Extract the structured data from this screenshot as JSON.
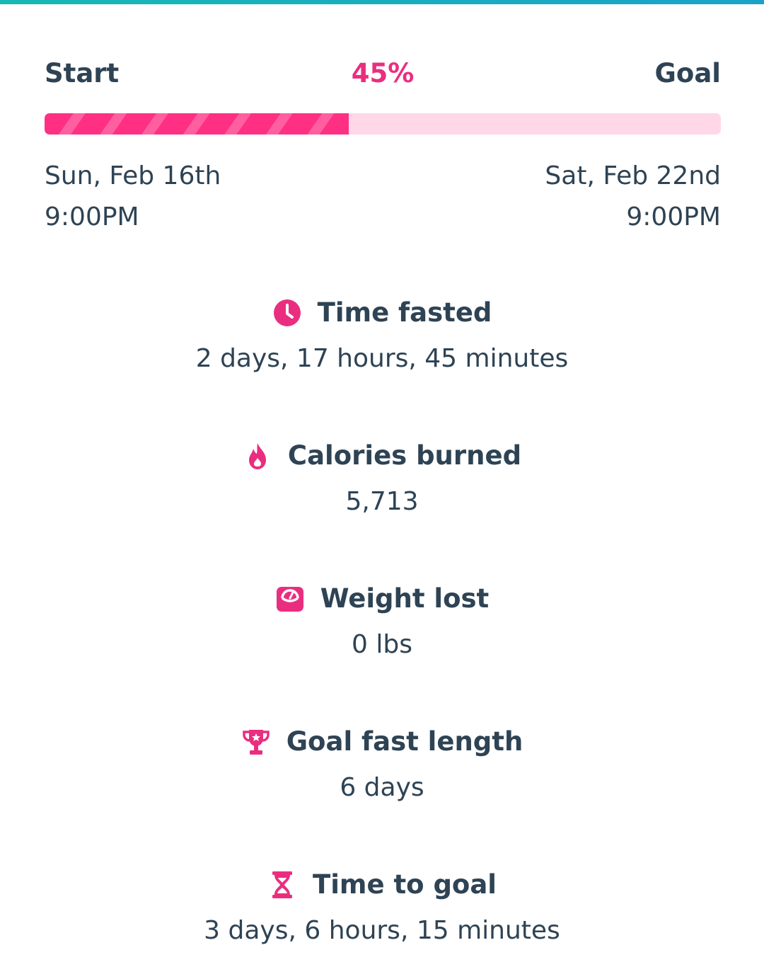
{
  "progress": {
    "start_label": "Start",
    "percent_label": "45%",
    "goal_label": "Goal",
    "percent_value": 0.45,
    "start_date": "Sun, Feb 16th",
    "start_time": "9:00PM",
    "goal_date": "Sat, Feb 22nd",
    "goal_time": "9:00PM"
  },
  "colors": {
    "accent": "#ea2e7f",
    "text": "#2e4354",
    "track": "#ffd7e7",
    "top_strip": "#16b9b3"
  },
  "stats": [
    {
      "icon": "clock-icon",
      "title": "Time fasted",
      "value": "2 days, 17 hours, 45 minutes"
    },
    {
      "icon": "flame-icon",
      "title": "Calories burned",
      "value": "5,713"
    },
    {
      "icon": "scale-icon",
      "title": "Weight lost",
      "value": "0 lbs"
    },
    {
      "icon": "trophy-icon",
      "title": "Goal fast length",
      "value": "6 days"
    },
    {
      "icon": "hourglass-icon",
      "title": "Time to goal",
      "value": "3 days, 6 hours, 15 minutes"
    }
  ]
}
